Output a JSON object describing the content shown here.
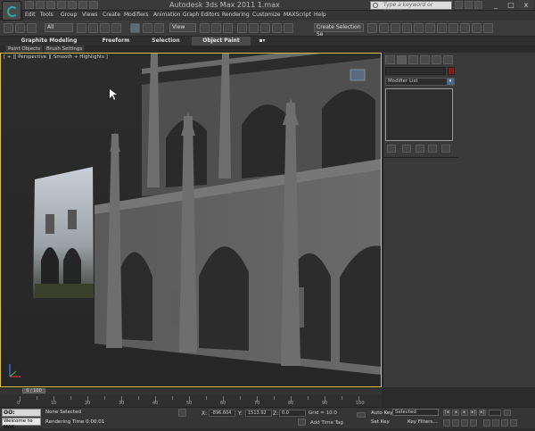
{
  "title_bar": {
    "app_title": "Autodesk 3ds Max  2011       1.max",
    "search_placeholder": "Type a keyword or phrase",
    "minimize": "_",
    "maximize": "□",
    "close": "x"
  },
  "menu": {
    "items": [
      "Edit",
      "Tools",
      "Group",
      "Views",
      "Create",
      "Modifiers",
      "Animation",
      "Graph Editors",
      "Rendering",
      "Customize",
      "MAXScript",
      "Help"
    ]
  },
  "toolbar": {
    "selection_filter": "All",
    "ref_coord": "View",
    "named_selection": "Create Selection Se"
  },
  "ribbon": {
    "tabs": [
      "Graphite Modeling Tools",
      "Freeform",
      "Selection",
      "Object Paint"
    ],
    "sub_tabs": [
      "Paint Objects",
      "Brush Settings"
    ]
  },
  "viewport": {
    "label": "[ + ][ Perspective ][ Smooth + Highlights ]"
  },
  "command_panel": {
    "modifier_list": "Modifier List",
    "accent_color": "#8a1a1a"
  },
  "timeline": {
    "slider_label": "0 / 100",
    "ticks": [
      "0",
      "10",
      "20",
      "30",
      "40",
      "50",
      "60",
      "70",
      "80",
      "90",
      "100"
    ]
  },
  "status": {
    "listener_top": "OO:",
    "listener_bottom": "Welcome to MAX",
    "selection_info": "None Selected",
    "render_time": "Rendering Time  0:00:01",
    "x_label": "X:",
    "x_value": "-896.604",
    "y_label": "Y:",
    "y_value": "1513.92",
    "z_label": "Z:",
    "z_value": "0.0",
    "grid": "Grid = 10.0",
    "add_time_tag": "Add Time Tag",
    "auto_key": "Auto Key",
    "selected": "Selected",
    "set_key": "Set Key",
    "key_filters": "Key Filters..."
  }
}
